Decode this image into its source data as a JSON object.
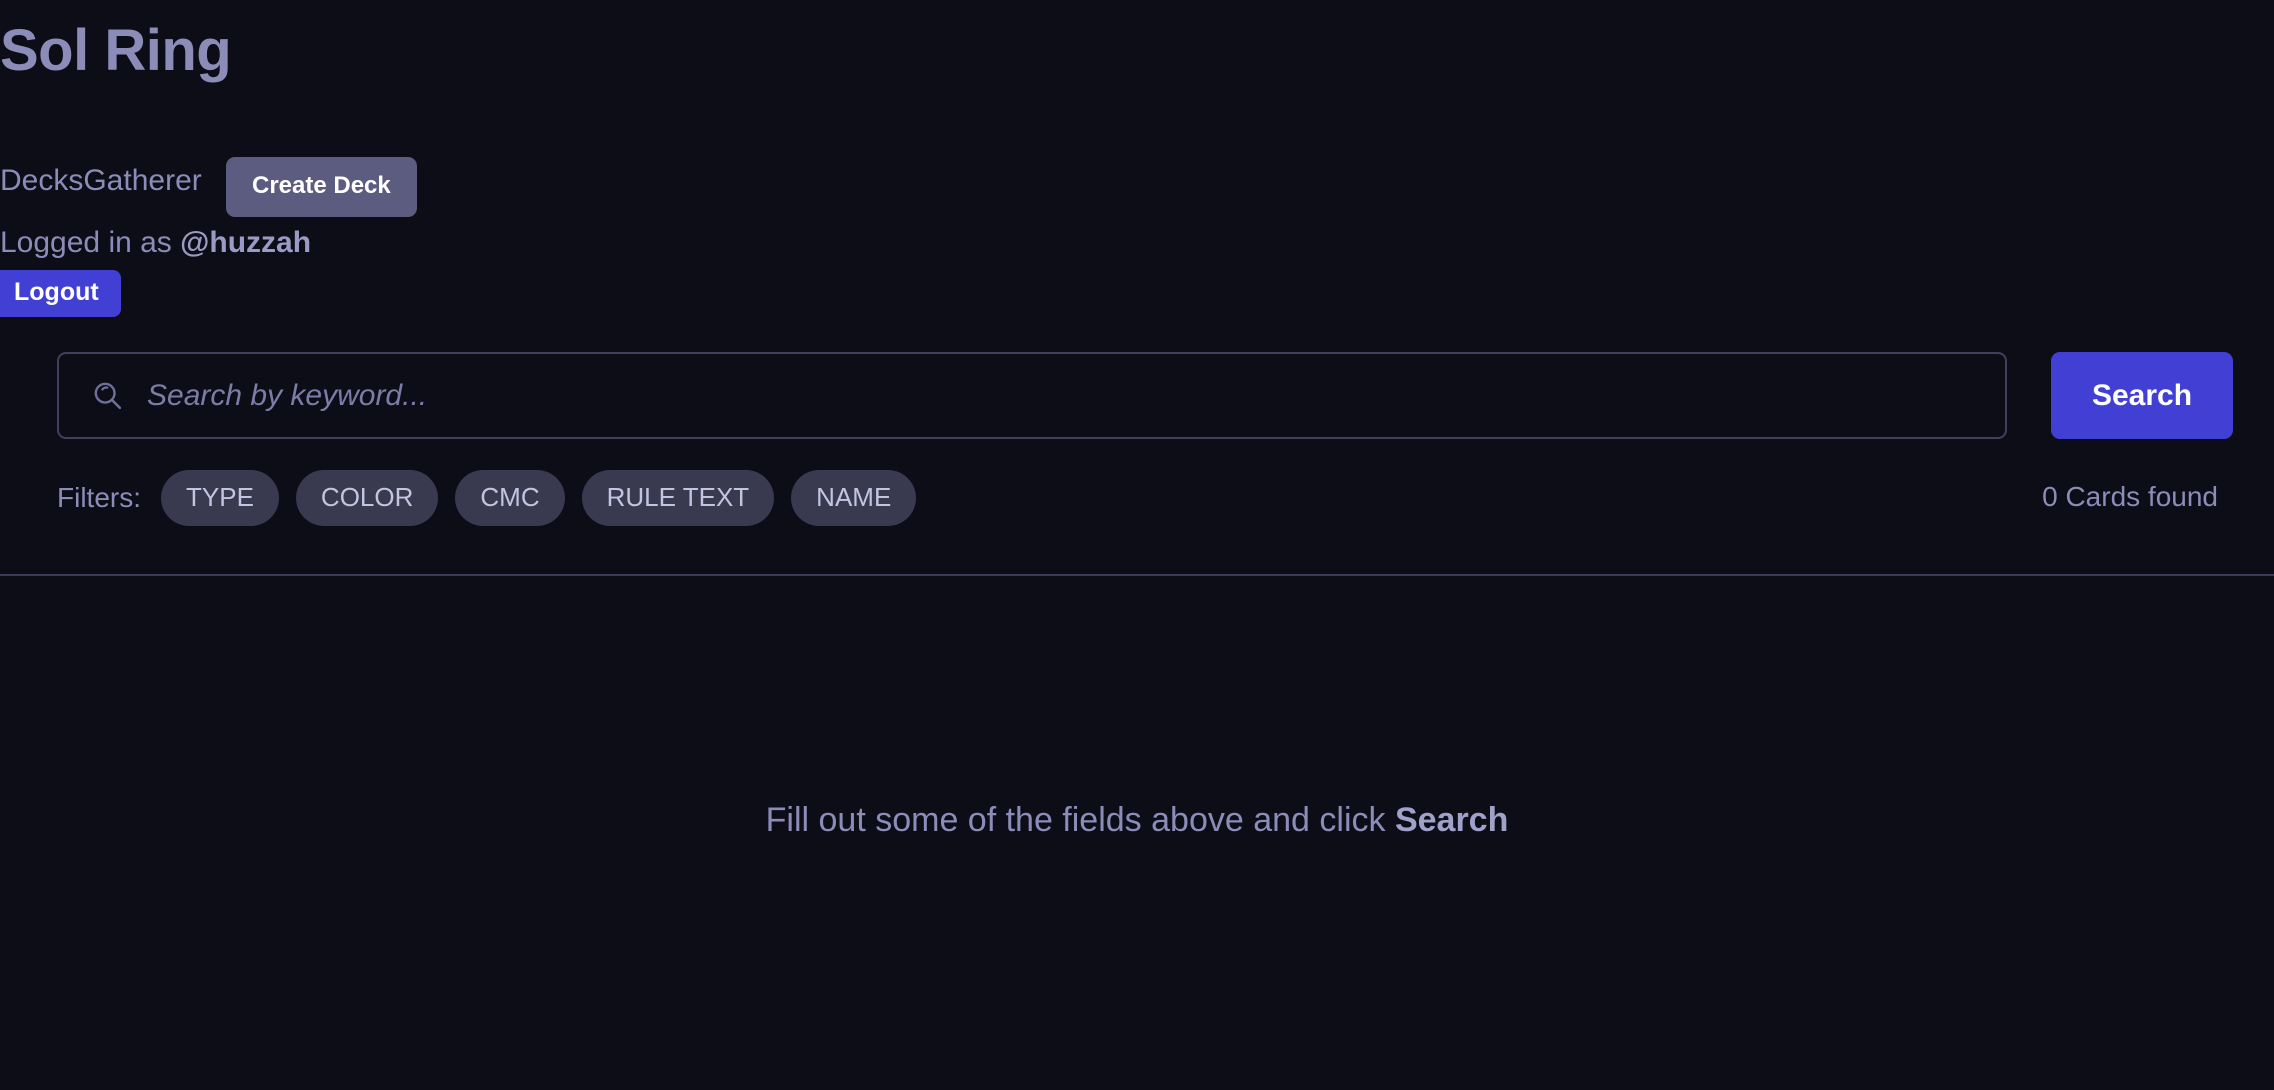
{
  "header": {
    "page_title": "Sol Ring",
    "brand": "DecksGatherer",
    "create_deck_label": "Create Deck",
    "logged_in_prefix": "Logged in as ",
    "username": "@huzzah",
    "logout_label": "Logout"
  },
  "search": {
    "placeholder": "Search by keyword...",
    "value": "",
    "icon": "search-icon",
    "button_label": "Search",
    "results_count": "0 Cards found"
  },
  "filters": {
    "label": "Filters:",
    "items": [
      {
        "label": "TYPE"
      },
      {
        "label": "COLOR"
      },
      {
        "label": "CMC"
      },
      {
        "label": "RULE TEXT"
      },
      {
        "label": "NAME"
      }
    ]
  },
  "empty_state": {
    "text_before": "Fill out some of the fields above and click ",
    "emphasis": "Search"
  },
  "colors": {
    "background": "#0d0d18",
    "accent": "#4240d4",
    "muted_accent": "#5c5c80",
    "pill": "#393950",
    "text": "#8b8cb8",
    "border": "#3f3f5e",
    "divider": "#3b3b58"
  }
}
